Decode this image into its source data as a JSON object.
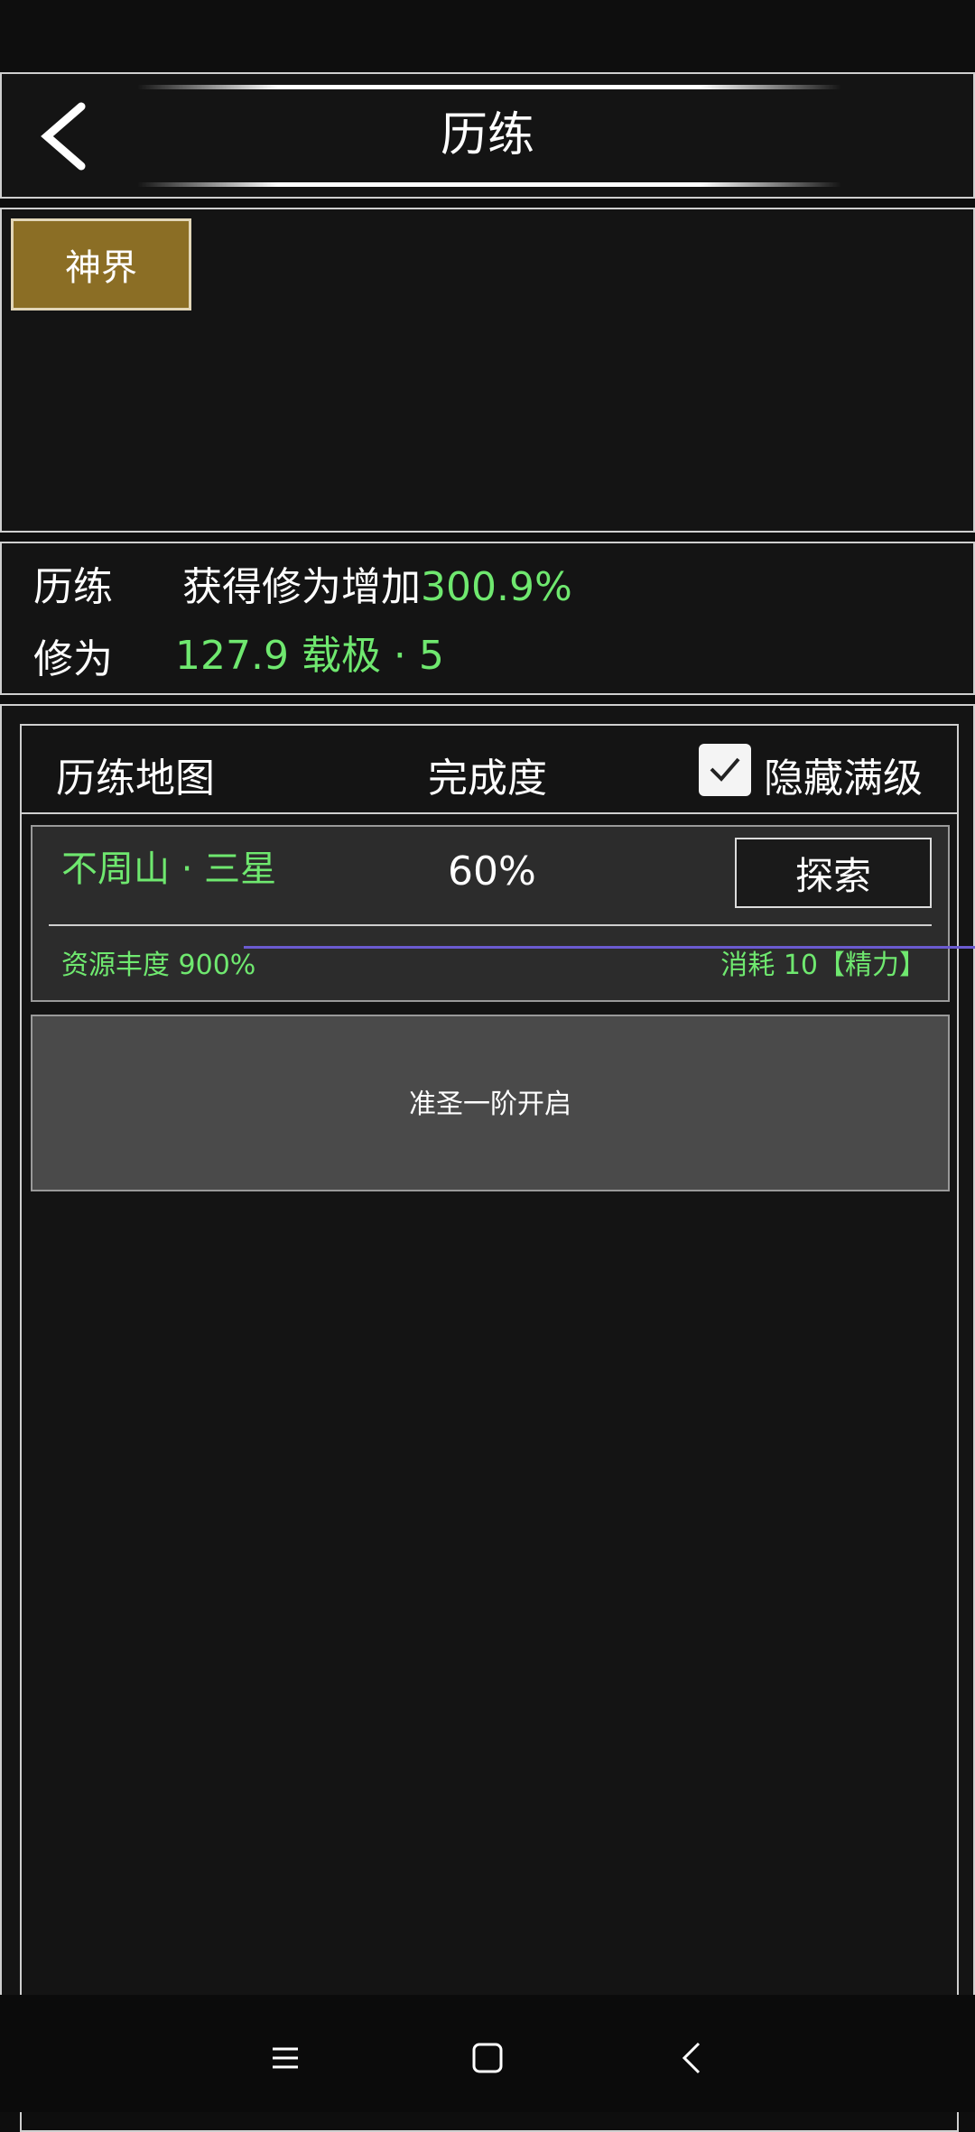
{
  "header": {
    "title": "历练"
  },
  "realms": [
    {
      "label": "神界"
    }
  ],
  "stats": {
    "line1": {
      "label": "历练",
      "prefix": "获得修为增加",
      "value": "300.9%"
    },
    "line2": {
      "label": "修为",
      "value": "127.9 载极 · 5"
    }
  },
  "map_list": {
    "col_map": "历练地图",
    "col_completion": "完成度",
    "hide_maxed_label": "隐藏满级",
    "hide_maxed_checked": true
  },
  "maps": [
    {
      "name": "不周山 · 三星",
      "completion": "60%",
      "explore_label": "探索",
      "resource": "资源丰度 900%",
      "cost": "消耗 10【精力】"
    }
  ],
  "locked": {
    "text": "准圣一阶开启"
  },
  "colors": {
    "accent_green": "#6fe86f",
    "realm_tab": "#8b6e25",
    "background": "#141414"
  },
  "icons": {
    "back": "chevron-left-icon",
    "menu": "menu-icon",
    "home": "home-icon",
    "nav_back": "back-icon"
  }
}
